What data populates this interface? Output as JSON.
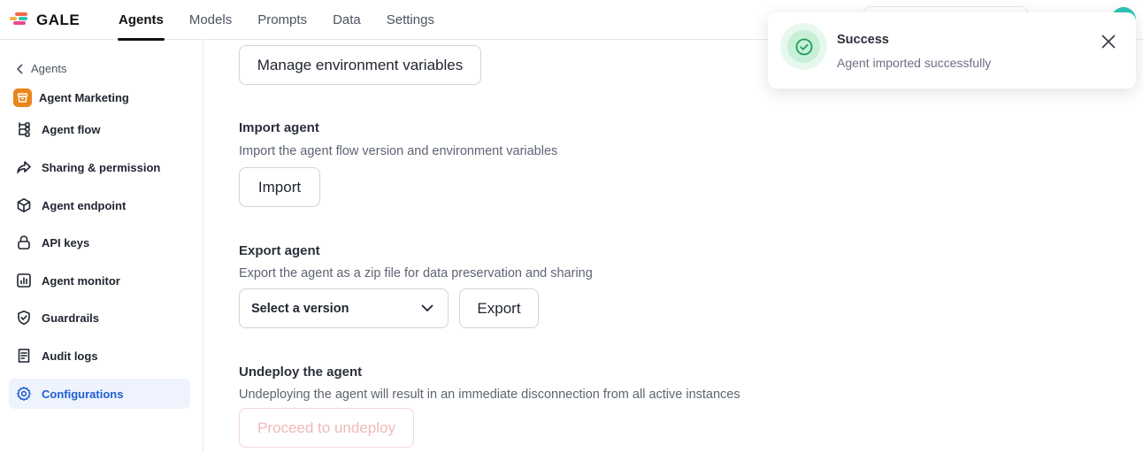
{
  "app": {
    "brand": "GALE",
    "logo_colors": [
      "#f2674a",
      "#f2b441",
      "#2ec4b6",
      "#e84a8a"
    ]
  },
  "nav": {
    "items": [
      {
        "label": "Agents",
        "active": true
      },
      {
        "label": "Models",
        "active": false
      },
      {
        "label": "Prompts",
        "active": false
      },
      {
        "label": "Data",
        "active": false
      },
      {
        "label": "Settings",
        "active": false
      }
    ]
  },
  "sidebar": {
    "back_label": "Agents",
    "agent_name": "Agent Marketing",
    "items": [
      {
        "label": "Agent flow",
        "icon": "flow-icon"
      },
      {
        "label": "Sharing & permission",
        "icon": "share-icon"
      },
      {
        "label": "Agent endpoint",
        "icon": "cube-icon"
      },
      {
        "label": "API keys",
        "icon": "lock-icon"
      },
      {
        "label": "Agent monitor",
        "icon": "chart-icon"
      },
      {
        "label": "Guardrails",
        "icon": "shield-icon"
      },
      {
        "label": "Audit logs",
        "icon": "document-icon"
      },
      {
        "label": "Configurations",
        "icon": "gear-icon",
        "active": true
      }
    ]
  },
  "main": {
    "manage_env_button": "Manage environment variables",
    "import": {
      "title": "Import agent",
      "description": "Import the agent flow version and environment variables",
      "button": "Import"
    },
    "export": {
      "title": "Export agent",
      "description": "Export the agent as a zip file for data preservation and sharing",
      "select_placeholder": "Select a version",
      "button": "Export"
    },
    "undeploy": {
      "title": "Undeploy the agent",
      "description": "Undeploying the agent will result in an immediate disconnection from all active instances",
      "button": "Proceed to undeploy"
    }
  },
  "toast": {
    "title": "Success",
    "message": "Agent imported successfully"
  },
  "colors": {
    "accent": "#1f5fd1",
    "success": "#1f9d55",
    "danger_muted": "#f2b8b8"
  }
}
